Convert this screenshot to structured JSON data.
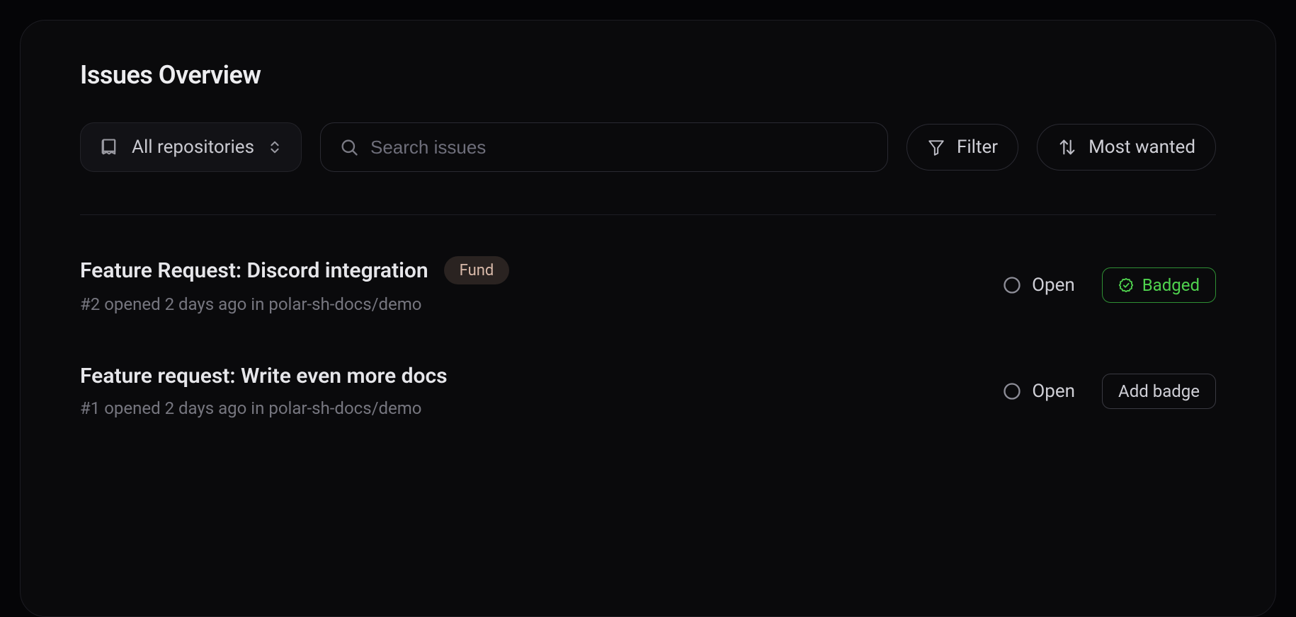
{
  "header": {
    "title": "Issues Overview"
  },
  "toolbar": {
    "repo_label": "All repositories",
    "search_placeholder": "Search issues",
    "filter_label": "Filter",
    "sort_label": "Most wanted"
  },
  "issues": [
    {
      "title": "Feature Request: Discord integration",
      "fund_label": "Fund",
      "has_fund": true,
      "meta": "#2 opened 2 days ago in polar-sh-docs/demo",
      "status": "Open",
      "badge_state": "badged",
      "badge_label": "Badged"
    },
    {
      "title": "Feature request: Write even more docs",
      "fund_label": "",
      "has_fund": false,
      "meta": "#1 opened 2 days ago in polar-sh-docs/demo",
      "status": "Open",
      "badge_state": "add",
      "badge_label": "Add badge"
    }
  ]
}
